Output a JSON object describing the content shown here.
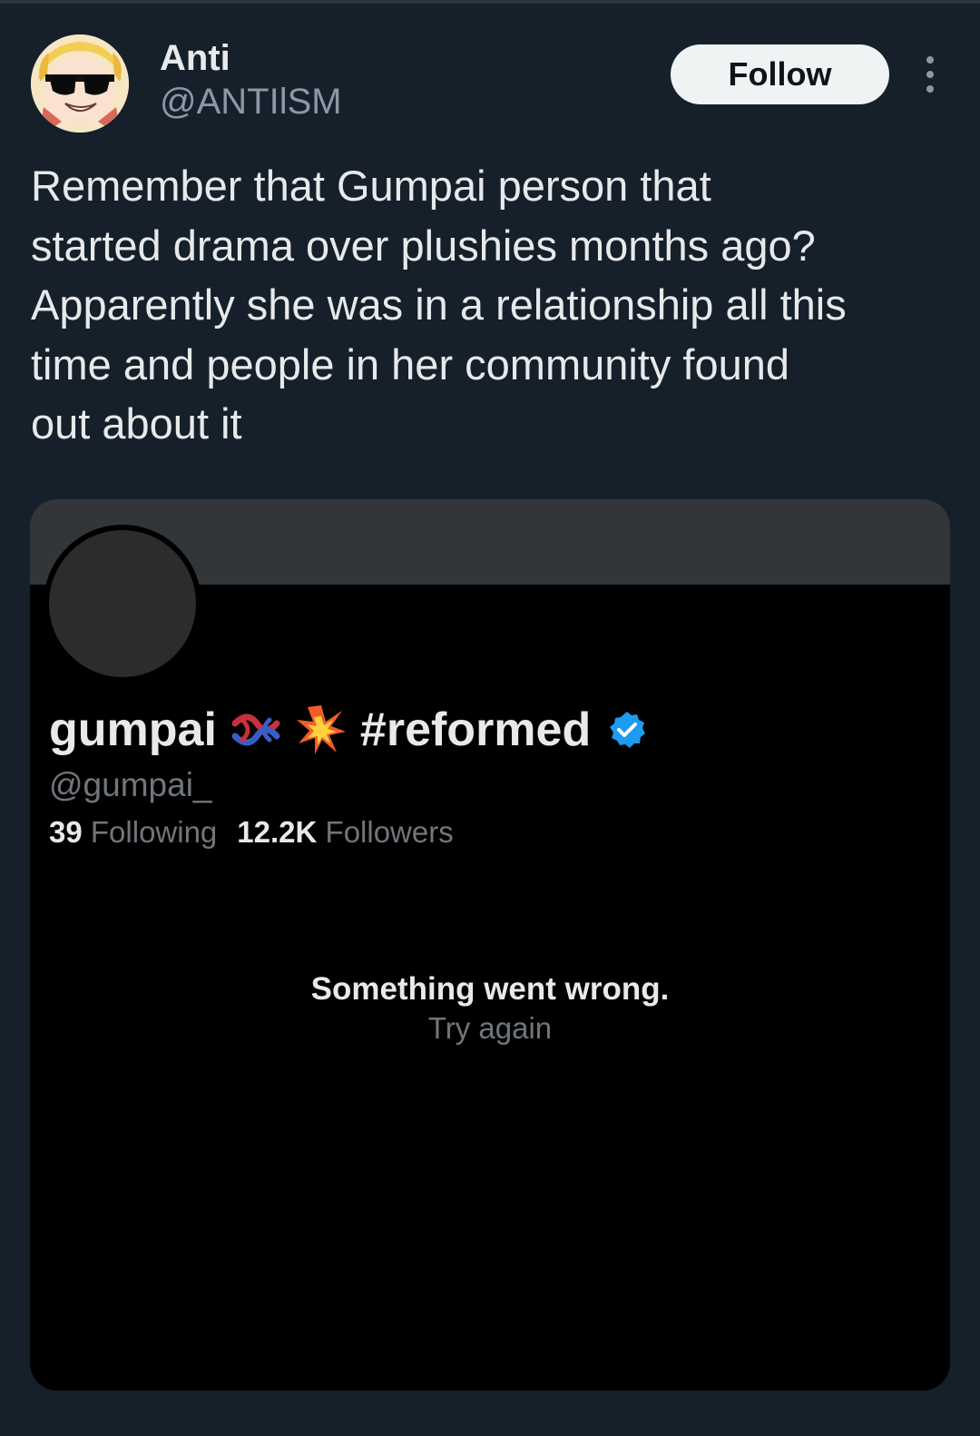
{
  "tweet": {
    "author": {
      "name": "Anti",
      "handle": "@ANTIlSM"
    },
    "follow_label": "Follow",
    "text": "Remember that Gumpai person that\nstarted drama over plushies months ago?\nApparently she was in a relationship all this\ntime and people in her community found\nout about it"
  },
  "embedded_profile": {
    "display_name": "gumpai",
    "emojis": [
      "knot-icon",
      "collision-icon"
    ],
    "name_tag": "#reformed",
    "verified": true,
    "handle": "@gumpai_",
    "following_count": "39",
    "following_label": "Following",
    "followers_count": "12.2K",
    "followers_label": "Followers",
    "error_message": "Something went wrong.",
    "retry_label": "Try again"
  },
  "colors": {
    "background": "#15202b",
    "card_background": "#000000",
    "banner": "#333639",
    "verified_blue": "#1d9bf0",
    "primary_text": "#e7e9ea",
    "secondary_text": "#8b98a5"
  }
}
